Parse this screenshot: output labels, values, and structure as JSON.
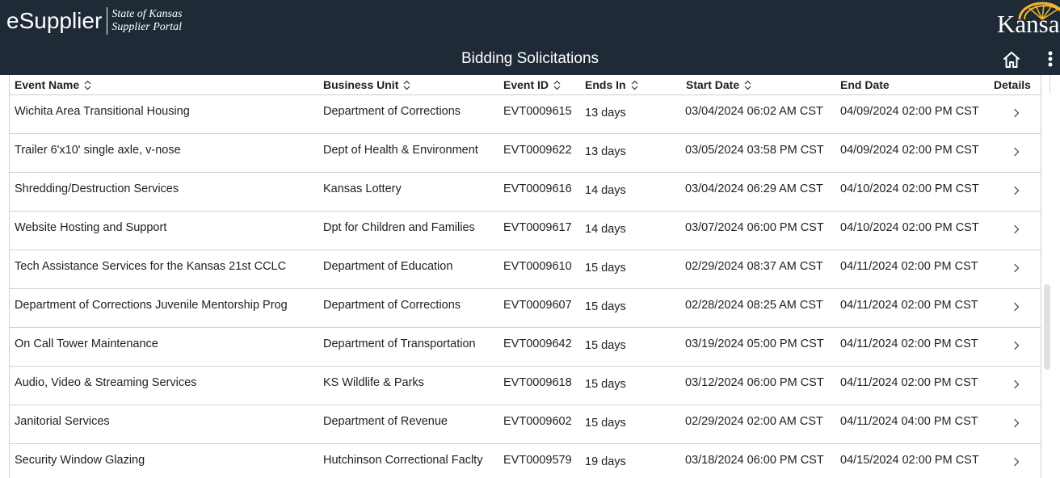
{
  "header": {
    "brand_name": "eSupplier",
    "brand_sub_line1": "State of Kansas",
    "brand_sub_line2": "Supplier Portal",
    "logo_text": "Kansas",
    "page_title": "Bidding Solicitations",
    "home_icon": "home-icon",
    "more_icon": "more-vertical-icon"
  },
  "colors": {
    "header_bg": "#1e2a36",
    "logo_gold": "#f2b632",
    "border": "#d0d0d0"
  },
  "table": {
    "columns": [
      {
        "label": "Event Name",
        "sortable": true
      },
      {
        "label": "Business Unit",
        "sortable": true
      },
      {
        "label": "Event ID",
        "sortable": true
      },
      {
        "label": "Ends In",
        "sortable": true
      },
      {
        "label": "Start Date",
        "sortable": true
      },
      {
        "label": "End Date",
        "sortable": false
      },
      {
        "label": "Details",
        "sortable": false
      }
    ],
    "rows": [
      {
        "name": "Wichita Area Transitional Housing",
        "business_unit": "Department of Corrections",
        "event_id": "EVT0009615",
        "ends_in": "13 days",
        "start_date": "03/04/2024 06:02 AM CST",
        "end_date": "04/09/2024 02:00 PM CST"
      },
      {
        "name": "Trailer 6'x10' single axle, v-nose",
        "business_unit": "Dept of Health & Environment",
        "event_id": "EVT0009622",
        "ends_in": "13 days",
        "start_date": "03/05/2024 03:58 PM CST",
        "end_date": "04/09/2024 02:00 PM CST"
      },
      {
        "name": "Shredding/Destruction Services",
        "business_unit": "Kansas Lottery",
        "event_id": "EVT0009616",
        "ends_in": "14 days",
        "start_date": "03/04/2024 06:29 AM CST",
        "end_date": "04/10/2024 02:00 PM CST"
      },
      {
        "name": "Website Hosting and Support",
        "business_unit": "Dpt for Children and Families",
        "event_id": "EVT0009617",
        "ends_in": "14 days",
        "start_date": "03/07/2024 06:00 PM CST",
        "end_date": "04/10/2024 02:00 PM CST"
      },
      {
        "name": "Tech Assistance Services for the Kansas 21st CCLC",
        "business_unit": "Department of Education",
        "event_id": "EVT0009610",
        "ends_in": "15 days",
        "start_date": "02/29/2024 08:37 AM CST",
        "end_date": "04/11/2024 02:00 PM CST"
      },
      {
        "name": "Department of Corrections Juvenile Mentorship Prog",
        "business_unit": "Department of Corrections",
        "event_id": "EVT0009607",
        "ends_in": "15 days",
        "start_date": "02/28/2024 08:25 AM CST",
        "end_date": "04/11/2024 02:00 PM CST"
      },
      {
        "name": "On Call Tower Maintenance",
        "business_unit": "Department of Transportation",
        "event_id": "EVT0009642",
        "ends_in": "15 days",
        "start_date": "03/19/2024 05:00 PM CST",
        "end_date": "04/11/2024 02:00 PM CST"
      },
      {
        "name": "Audio, Video & Streaming Services",
        "business_unit": "KS Wildlife & Parks",
        "event_id": "EVT0009618",
        "ends_in": "15 days",
        "start_date": "03/12/2024 06:00 PM CST",
        "end_date": "04/11/2024 02:00 PM CST"
      },
      {
        "name": "Janitorial Services",
        "business_unit": "Department of Revenue",
        "event_id": "EVT0009602",
        "ends_in": "15 days",
        "start_date": "02/29/2024 02:00 AM CST",
        "end_date": "04/11/2024 04:00 PM CST"
      },
      {
        "name": "Security Window Glazing",
        "business_unit": "Hutchinson Correctional Faclty",
        "event_id": "EVT0009579",
        "ends_in": "19 days",
        "start_date": "03/18/2024 06:00 PM CST",
        "end_date": "04/15/2024 02:00 PM CST"
      }
    ]
  }
}
